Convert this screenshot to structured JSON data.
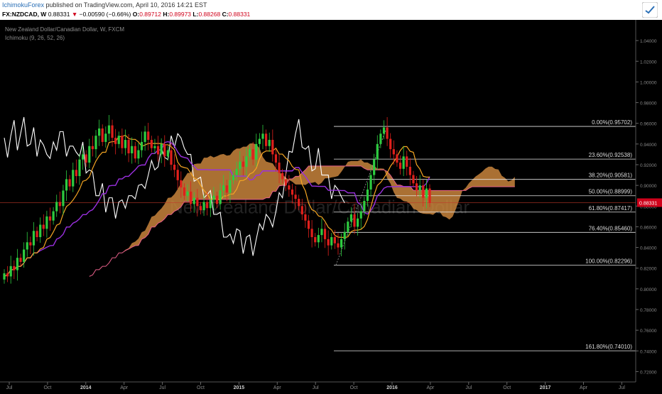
{
  "header": {
    "author": "IchimokuForex",
    "published": "published on TradingView.com, April 10, 2016 14:21 EST",
    "symbol": "FX:NZDCAD, W",
    "last": "0.88331",
    "change": "−0.00590 (−0.66%)",
    "open_label": "O:",
    "open": "0.89712",
    "high_label": "H:",
    "high": "0.89973",
    "low_label": "L:",
    "low": "0.88268",
    "close_label": "C:",
    "close": "0.88331"
  },
  "legend": {
    "title": "New Zealand Dollar/Canadian Dollar, W, FXCM",
    "indicator": "Ichimoku (9, 26, 52, 26)"
  },
  "watermark": "New Zealand Dollar/Canadian Dollar",
  "colors": {
    "background": "#000000",
    "cloud": "#c8843c",
    "tenkan": "#f5a623",
    "kijun": "#9b30e0",
    "chikou": "#ffffff",
    "senkou_b": "#e8608a",
    "bull": "#2ecc40",
    "bear": "#e0201c",
    "fib": "#e6e6e6",
    "price_line": "#c0392b",
    "price_badge": "#d0021b"
  },
  "chart_data": {
    "type": "candlestick",
    "ylim": [
      0.71,
      1.06
    ],
    "y_ticks": [
      "0.72000",
      "0.74000",
      "0.76000",
      "0.78000",
      "0.80000",
      "0.82000",
      "0.84000",
      "0.86000",
      "0.88000",
      "0.90000",
      "0.92000",
      "0.94000",
      "0.96000",
      "0.98000",
      "1.00000",
      "1.02000",
      "1.04000"
    ],
    "x_ticks": [
      "Jul",
      "Oct",
      "2014",
      "Apr",
      "Jul",
      "Oct",
      "2015",
      "Apr",
      "Jul",
      "Oct",
      "2016",
      "Apr",
      "Jul",
      "Oct",
      "2017",
      "Apr",
      "Jul"
    ],
    "current_price": "0.88331",
    "fibonacci": [
      {
        "label": "0.00%(0.95702)",
        "price": 0.95702
      },
      {
        "label": "23.60%(0.92538)",
        "price": 0.92538
      },
      {
        "label": "38.20%(0.90581)",
        "price": 0.90581
      },
      {
        "label": "50.00%(0.88999)",
        "price": 0.88999
      },
      {
        "label": "61.80%(0.87417)",
        "price": 0.87417
      },
      {
        "label": "76.40%(0.85460)",
        "price": 0.8546
      },
      {
        "label": "100.00%(0.82296)",
        "price": 0.82296
      },
      {
        "label": "161.80%(0.74010)",
        "price": 0.7401
      }
    ],
    "closes": [
      0.815,
      0.812,
      0.822,
      0.818,
      0.83,
      0.826,
      0.838,
      0.845,
      0.842,
      0.856,
      0.85,
      0.862,
      0.858,
      0.87,
      0.866,
      0.875,
      0.884,
      0.88,
      0.895,
      0.906,
      0.899,
      0.915,
      0.909,
      0.925,
      0.93,
      0.922,
      0.938,
      0.935,
      0.948,
      0.955,
      0.942,
      0.95,
      0.958,
      0.946,
      0.94,
      0.948,
      0.936,
      0.944,
      0.931,
      0.938,
      0.926,
      0.934,
      0.942,
      0.952,
      0.944,
      0.936,
      0.938,
      0.93,
      0.94,
      0.928,
      0.934,
      0.92,
      0.915,
      0.905,
      0.898,
      0.89,
      0.894,
      0.882,
      0.888,
      0.88,
      0.876,
      0.884,
      0.878,
      0.886,
      0.89,
      0.882,
      0.895,
      0.9,
      0.893,
      0.905,
      0.91,
      0.916,
      0.923,
      0.918,
      0.928,
      0.935,
      0.925,
      0.94,
      0.945,
      0.95,
      0.938,
      0.944,
      0.93,
      0.922,
      0.912,
      0.906,
      0.9,
      0.896,
      0.891,
      0.887,
      0.88,
      0.872,
      0.866,
      0.858,
      0.85,
      0.845,
      0.852,
      0.858,
      0.848,
      0.842,
      0.85,
      0.844,
      0.84,
      0.848,
      0.855,
      0.865,
      0.872,
      0.86,
      0.868,
      0.875,
      0.885,
      0.896,
      0.91,
      0.925,
      0.94,
      0.95,
      0.956,
      0.945,
      0.935,
      0.93,
      0.922,
      0.916,
      0.928,
      0.918,
      0.91,
      0.902,
      0.895,
      0.9,
      0.888,
      0.897,
      0.883
    ]
  }
}
